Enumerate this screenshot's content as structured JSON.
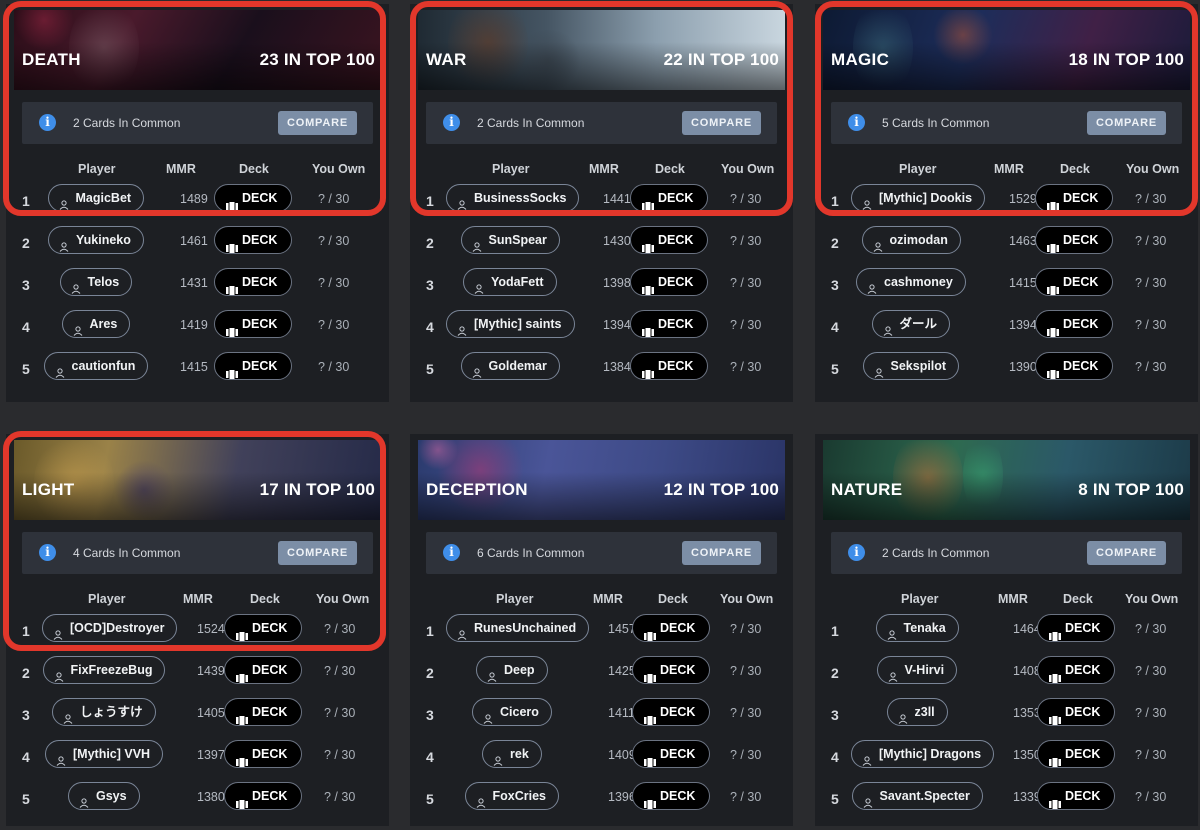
{
  "headers": {
    "player": "Player",
    "mmr": "MMR",
    "deck": "Deck",
    "own": "You Own"
  },
  "compare_label": "COMPARE",
  "deck_label": "DECK",
  "info_glyph": "i",
  "panels": [
    {
      "title": "DEATH",
      "count": "23 IN TOP 100",
      "common": "2 Cards In Common",
      "rows": [
        {
          "rank": "1",
          "player": "MagicBet",
          "mmr": "1489",
          "own": "? / 30"
        },
        {
          "rank": "2",
          "player": "Yukineko",
          "mmr": "1461",
          "own": "? / 30"
        },
        {
          "rank": "3",
          "player": "Telos",
          "mmr": "1431",
          "own": "? / 30"
        },
        {
          "rank": "4",
          "player": "Ares",
          "mmr": "1419",
          "own": "? / 30"
        },
        {
          "rank": "5",
          "player": "cautionfun",
          "mmr": "1415",
          "own": "? / 30"
        }
      ]
    },
    {
      "title": "WAR",
      "count": "22 IN TOP 100",
      "common": "2 Cards In Common",
      "rows": [
        {
          "rank": "1",
          "player": "BusinessSocks",
          "mmr": "1441",
          "own": "? / 30"
        },
        {
          "rank": "2",
          "player": "SunSpear",
          "mmr": "1430",
          "own": "? / 30"
        },
        {
          "rank": "3",
          "player": "YodaFett",
          "mmr": "1398",
          "own": "? / 30"
        },
        {
          "rank": "4",
          "player": "[Mythic] saints",
          "mmr": "1394",
          "own": "? / 30"
        },
        {
          "rank": "5",
          "player": "Goldemar",
          "mmr": "1384",
          "own": "? / 30"
        }
      ]
    },
    {
      "title": "MAGIC",
      "count": "18 IN TOP 100",
      "common": "5 Cards In Common",
      "rows": [
        {
          "rank": "1",
          "player": "[Mythic] Dookis",
          "mmr": "1529",
          "own": "? / 30"
        },
        {
          "rank": "2",
          "player": "ozimodan",
          "mmr": "1463",
          "own": "? / 30"
        },
        {
          "rank": "3",
          "player": "cashmoney",
          "mmr": "1415",
          "own": "? / 30"
        },
        {
          "rank": "4",
          "player": "ダール",
          "mmr": "1394",
          "own": "? / 30"
        },
        {
          "rank": "5",
          "player": "Sekspilot",
          "mmr": "1390",
          "own": "? / 30"
        }
      ]
    },
    {
      "title": "LIGHT",
      "count": "17 IN TOP 100",
      "common": "4 Cards In Common",
      "rows": [
        {
          "rank": "1",
          "player": "[OCD]Destroyer",
          "mmr": "1524",
          "own": "? / 30"
        },
        {
          "rank": "2",
          "player": "FixFreezeBug",
          "mmr": "1439",
          "own": "? / 30"
        },
        {
          "rank": "3",
          "player": "しょうすけ",
          "mmr": "1405",
          "own": "? / 30"
        },
        {
          "rank": "4",
          "player": "[Mythic] VVH",
          "mmr": "1397",
          "own": "? / 30"
        },
        {
          "rank": "5",
          "player": "Gsys",
          "mmr": "1380",
          "own": "? / 30"
        }
      ]
    },
    {
      "title": "DECEPTION",
      "count": "12 IN TOP 100",
      "common": "6 Cards In Common",
      "rows": [
        {
          "rank": "1",
          "player": "RunesUnchained",
          "mmr": "1457",
          "own": "? / 30"
        },
        {
          "rank": "2",
          "player": "Deep",
          "mmr": "1425",
          "own": "? / 30"
        },
        {
          "rank": "3",
          "player": "Cicero",
          "mmr": "1411",
          "own": "? / 30"
        },
        {
          "rank": "4",
          "player": "rek",
          "mmr": "1409",
          "own": "? / 30"
        },
        {
          "rank": "5",
          "player": "FoxCries",
          "mmr": "1396",
          "own": "? / 30"
        }
      ]
    },
    {
      "title": "NATURE",
      "count": "8 IN TOP 100",
      "common": "2 Cards In Common",
      "rows": [
        {
          "rank": "1",
          "player": "Tenaka",
          "mmr": "1464",
          "own": "? / 30"
        },
        {
          "rank": "2",
          "player": "V-Hirvi",
          "mmr": "1408",
          "own": "? / 30"
        },
        {
          "rank": "3",
          "player": "z3ll",
          "mmr": "1353",
          "own": "? / 30"
        },
        {
          "rank": "4",
          "player": "[Mythic] Dragons",
          "mmr": "1350",
          "own": "? / 30"
        },
        {
          "rank": "5",
          "player": "Savant.Specter",
          "mmr": "1339",
          "own": "? / 30"
        }
      ]
    }
  ],
  "colors": {
    "highlight": "#e2372b",
    "info": "#3f8ee9",
    "compare": "#7c8ea6",
    "panel": "#1d1f23"
  }
}
